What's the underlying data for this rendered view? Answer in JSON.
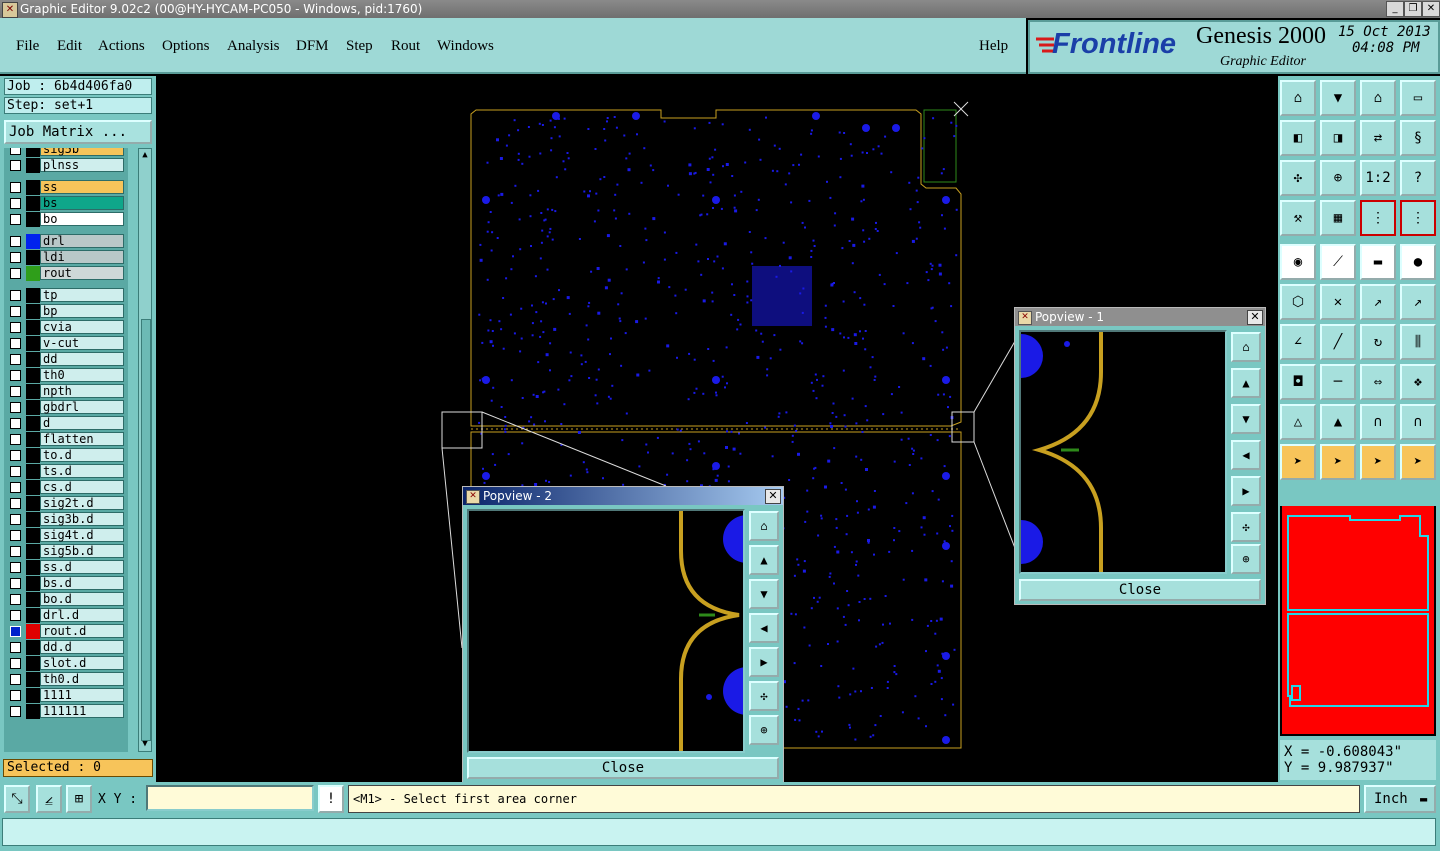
{
  "window": {
    "title": "Graphic Editor 9.02c2 (00@HY-HYCAM-PC050 - Windows, pid:1760)"
  },
  "menu": {
    "items": [
      "File",
      "Edit",
      "Actions",
      "Options",
      "Analysis",
      "DFM",
      "Step",
      "Rout",
      "Windows"
    ],
    "help": "Help"
  },
  "brand": {
    "logo": "Frontline",
    "product": "Genesis 2000",
    "module": "Graphic Editor",
    "date": "15 Oct 2013",
    "time": "04:08 PM"
  },
  "job": {
    "job_label": "Job : 6b4d406fa0",
    "step_label": "Step: set+1",
    "matrix_button": "Job Matrix ..."
  },
  "layers": [
    {
      "name": "sig5b",
      "color": "#f7c45a"
    },
    {
      "name": "plnss",
      "color": ""
    },
    {
      "name": "ss",
      "color": "#f7c45a"
    },
    {
      "name": "bs",
      "color": "#0fa68a"
    },
    {
      "name": "bo",
      "color": "#ffffff"
    },
    {
      "name": "drl",
      "color": "#b9c8c8",
      "swatch": "#0022ee"
    },
    {
      "name": "ldi",
      "color": "#b9c8c8"
    },
    {
      "name": "rout",
      "color": "#cfd8d8",
      "swatch": "#2f9e1a"
    },
    {
      "name": "tp",
      "color": ""
    },
    {
      "name": "bp",
      "color": ""
    },
    {
      "name": "cvia",
      "color": ""
    },
    {
      "name": "v-cut",
      "color": ""
    },
    {
      "name": "dd",
      "color": ""
    },
    {
      "name": "th0",
      "color": ""
    },
    {
      "name": "npth",
      "color": ""
    },
    {
      "name": "gbdrl",
      "color": ""
    },
    {
      "name": "d",
      "color": ""
    },
    {
      "name": "flatten",
      "color": ""
    },
    {
      "name": "to.d",
      "color": ""
    },
    {
      "name": "ts.d",
      "color": ""
    },
    {
      "name": "cs.d",
      "color": ""
    },
    {
      "name": "sig2t.d",
      "color": ""
    },
    {
      "name": "sig3b.d",
      "color": ""
    },
    {
      "name": "sig4t.d",
      "color": ""
    },
    {
      "name": "sig5b.d",
      "color": ""
    },
    {
      "name": "ss.d",
      "color": ""
    },
    {
      "name": "bs.d",
      "color": ""
    },
    {
      "name": "bo.d",
      "color": ""
    },
    {
      "name": "drl.d",
      "color": ""
    },
    {
      "name": "rout.d",
      "color": "",
      "swatch": "#e00000",
      "active": true
    },
    {
      "name": "dd.d",
      "color": ""
    },
    {
      "name": "slot.d",
      "color": ""
    },
    {
      "name": "th0.d",
      "color": ""
    },
    {
      "name": "1111",
      "color": ""
    },
    {
      "name": "111111",
      "color": ""
    }
  ],
  "selected": "Selected : 0",
  "popview1": {
    "title": "Popview - 1",
    "close": "Close"
  },
  "popview2": {
    "title": "Popview - 2",
    "close": "Close"
  },
  "coords": {
    "x": "X = -0.608043\"",
    "y": "Y = 9.987937\""
  },
  "bottom": {
    "xy_label": "X Y :",
    "xy_value": "",
    "message": "<M1> - Select first area corner",
    "unit": "Inch"
  },
  "colors": {
    "panel": "#79c7c2",
    "board_pads": "#1a1ae6",
    "route_gold": "#c8a020",
    "outline_red": "#ff0000"
  }
}
